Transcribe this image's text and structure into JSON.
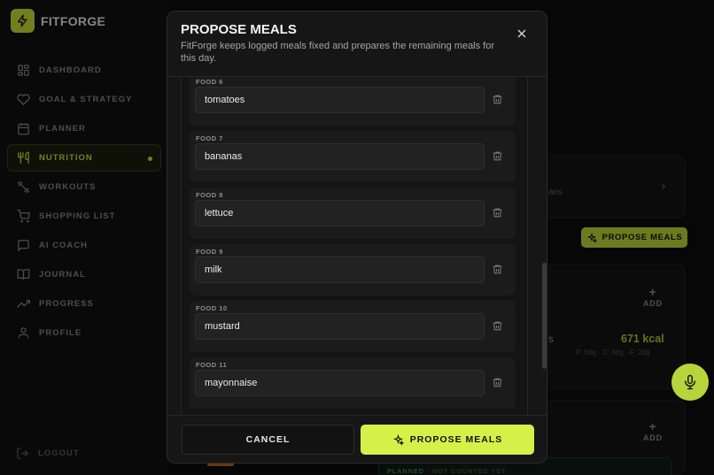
{
  "app": {
    "brand": "FITFORGE"
  },
  "sidebar": {
    "items": [
      {
        "label": "DASHBOARD",
        "icon": "dashboard-icon",
        "active": false
      },
      {
        "label": "GOAL & STRATEGY",
        "icon": "heart-icon",
        "active": false
      },
      {
        "label": "PLANNER",
        "icon": "calendar-icon",
        "active": false
      },
      {
        "label": "NUTRITION",
        "icon": "utensils-icon",
        "active": true
      },
      {
        "label": "WORKOUTS",
        "icon": "dumbbell-icon",
        "active": false
      },
      {
        "label": "SHOPPING LIST",
        "icon": "cart-icon",
        "active": false
      },
      {
        "label": "AI COACH",
        "icon": "chat-icon",
        "active": false
      },
      {
        "label": "JOURNAL",
        "icon": "book-icon",
        "active": false
      },
      {
        "label": "PROGRESS",
        "icon": "trending-up-icon",
        "active": false
      },
      {
        "label": "PROFILE",
        "icon": "user-icon",
        "active": false
      }
    ],
    "logout": "LOGOUT"
  },
  "background": {
    "propose_label": "PROPOSE MEALS",
    "add_label": "ADD",
    "plans_fragment": "ans",
    "meal_fragment": "s",
    "kcal": "671 kcal",
    "macros": "P: 56g · C: 68g · F: 20g",
    "planned": "PLANNED",
    "not_counted": "· NOT COUNTED YET"
  },
  "modal": {
    "title": "PROPOSE MEALS",
    "description": "FitForge keeps logged meals fixed and prepares the remaining meals for this day.",
    "foods": [
      {
        "label": "FOOD 6",
        "value": "tomatoes"
      },
      {
        "label": "FOOD 7",
        "value": "bananas"
      },
      {
        "label": "FOOD 8",
        "value": "lettuce"
      },
      {
        "label": "FOOD 9",
        "value": "milk"
      },
      {
        "label": "FOOD 10",
        "value": "mustard"
      },
      {
        "label": "FOOD 11",
        "value": "mayonnaise"
      }
    ],
    "cancel_label": "CANCEL",
    "submit_label": "PROPOSE MEALS"
  },
  "colors": {
    "accent": "#d6f04a",
    "background": "#0d0d0d",
    "panel": "#161616"
  }
}
